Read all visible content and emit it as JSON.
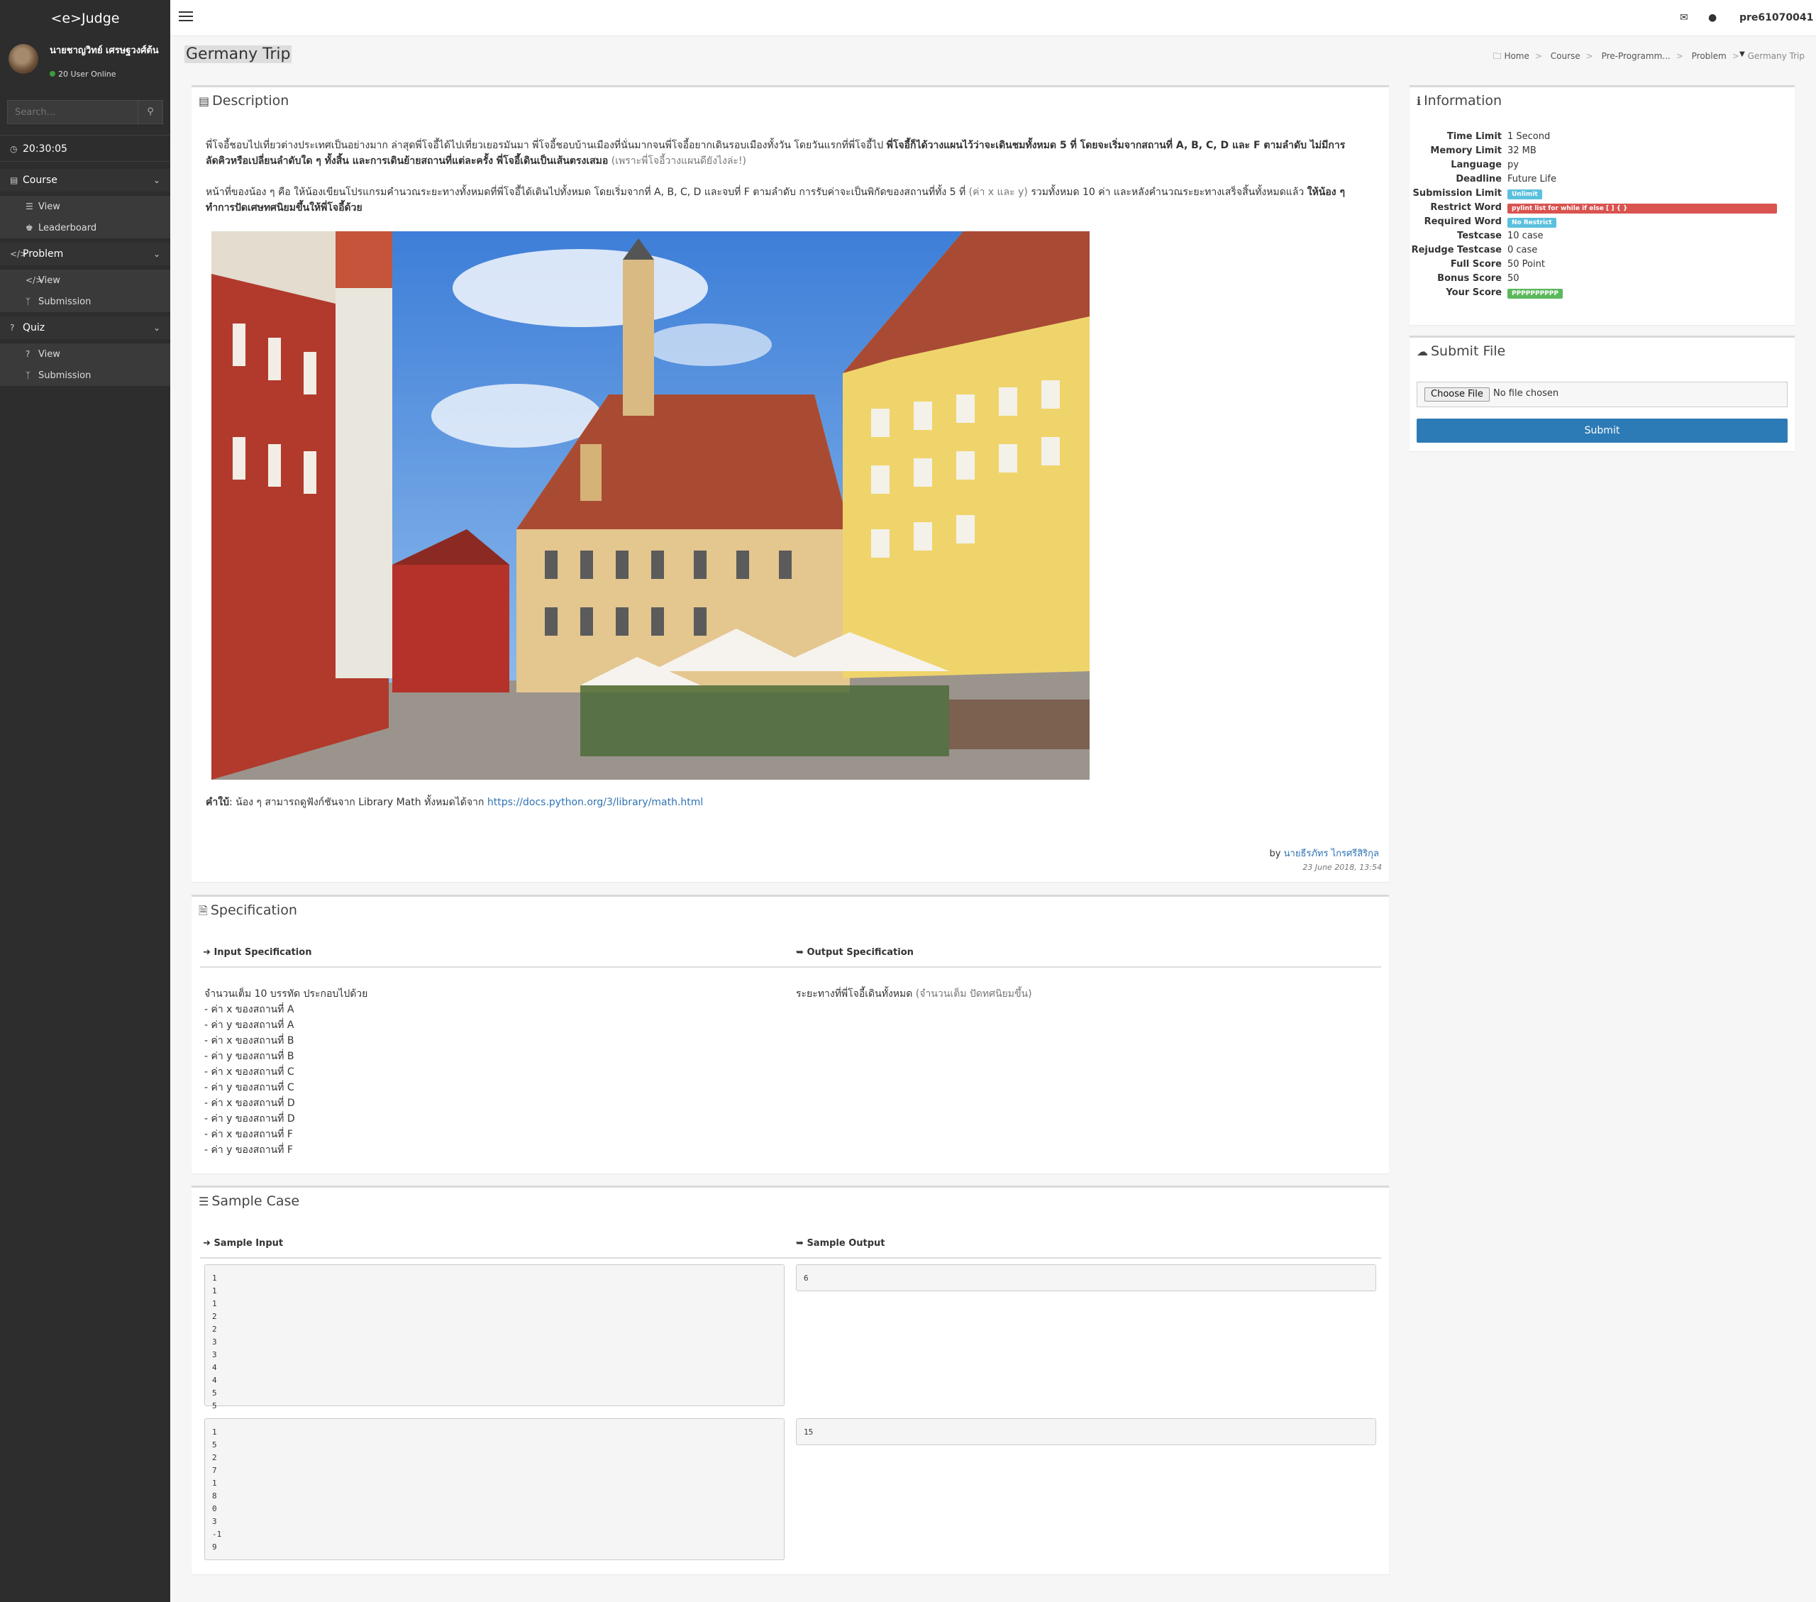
{
  "app": {
    "brand": "<e>Judge"
  },
  "sidebar": {
    "user_name": "นายชาญวิทย์ เศรษฐวงศ์ต้น",
    "online": "20 User Online",
    "search_placeholder": "Search...",
    "clock": "20:30:05",
    "sections": [
      {
        "label": "Course",
        "items": [
          {
            "label": "View"
          },
          {
            "label": "Leaderboard"
          }
        ]
      },
      {
        "label": "Problem",
        "items": [
          {
            "label": "View"
          },
          {
            "label": "Submission"
          }
        ]
      },
      {
        "label": "Quiz",
        "items": [
          {
            "label": "View"
          },
          {
            "label": "Submission"
          }
        ]
      }
    ]
  },
  "topbar": {
    "user": "pre61070041"
  },
  "page": {
    "title": "Germany Trip"
  },
  "breadcrumb": [
    "Home",
    "Course",
    "Pre-Programm...",
    "Problem",
    "Germany Trip"
  ],
  "description": {
    "heading": "Description",
    "p1_a": "พี่โจอี้ชอบไปเที่ยวต่างประเทศเป็นอย่างมาก ล่าสุดพี่โจอี้ได้ไปเที่ยวเยอรมันมา พี่โจอี้ชอบบ้านเมืองที่นั่นมากจนพี่โจอี้อยากเดินรอบเมืองทั้งวัน โดยวันแรกที่พี่โจอี้ไป",
    "p1_b": "พี่โจอี้ก็ได้วางแผนไว้ว่าจะเดินชมทั้งหมด 5 ที่ โดยจะเริ่มจากสถานที่ A, B, C, D และ F ตามลำดับ ไม่มีการลัดคิวหรือเปลี่ยนลำดับใด ๆ ทั้งสิ้น และการเดินย้ายสถานที่แต่ละครั้ง พี่โจอี้เดินเป็นเส้นตรงเสมอ",
    "p1_c": "(เพราะพี่โจอี้วางแผนดียังไงล่ะ!)",
    "p2_a": "หน้าที่ของน้อง ๆ คือ ให้น้องเขียนโปรแกรมคำนวณระยะทางทั้งหมดที่พี่โจอี้ได้เดินไปทั้งหมด โดยเริ่มจากที่ A, B, C, D และจบที่ F ตามลำดับ การรับค่าจะเป็นพิกัดของสถานที่ทั้ง 5 ที่",
    "p2_b": "(ค่า x และ y)",
    "p2_c": "รวมทั้งหมด 10 ค่า และหลังคำนวณระยะทางเสร็จสิ้นทั้งหมดแล้ว",
    "p2_d": "ให้น้อง ๆ ทำการปัดเศษทศนิยมขึ้นให้พี่โจอี้ด้วย",
    "hint_label": "คำใบ้",
    "hint_text": ": น้อง ๆ สามารถดูฟังก์ชันจาก Library Math ทั้งหมดได้จาก",
    "hint_link": "https://docs.python.org/3/library/math.html",
    "by": "by",
    "author": "นายธีรภัทร ไกรศรีสิริกุล",
    "date": "23 June 2018, 13:54"
  },
  "specification": {
    "heading": "Specification",
    "input_label": "Input Specification",
    "output_label": "Output Specification",
    "input_lines": [
      "จำนวนเต็ม 10 บรรทัด ประกอบไปด้วย",
      "- ค่า x ของสถานที่ A",
      "- ค่า y ของสถานที่ A",
      "- ค่า x ของสถานที่ B",
      "- ค่า y ของสถานที่ B",
      "- ค่า x ของสถานที่ C",
      "- ค่า y ของสถานที่ C",
      "- ค่า x ของสถานที่ D",
      "- ค่า y ของสถานที่ D",
      "- ค่า x ของสถานที่ F",
      "- ค่า y ของสถานที่ F"
    ],
    "output_a": "ระยะทางที่พี่โจอี้เดินทั้งหมด",
    "output_b": "(จำนวนเต็ม ปัดทศนิยมขึ้น)"
  },
  "samples": {
    "heading": "Sample Case",
    "input_label": "Sample Input",
    "output_label": "Sample Output",
    "cases": [
      {
        "input": "1\n1\n1\n2\n2\n3\n3\n4\n4\n5\n5",
        "output": "6"
      },
      {
        "input": "1\n5\n2\n7\n1\n8\n0\n3\n-1\n9",
        "output": "15"
      }
    ]
  },
  "information": {
    "heading": "Information",
    "rows": [
      {
        "k": "Time Limit",
        "v": "1 Second"
      },
      {
        "k": "Memory Limit",
        "v": "32 MB"
      },
      {
        "k": "Language",
        "v": "py"
      },
      {
        "k": "Deadline",
        "v": "Future Life"
      },
      {
        "k": "Submission Limit",
        "badge": "Unlimit",
        "color": "#5bc0de"
      },
      {
        "k": "Restrict Word",
        "badge": "pylint list for while if else [ ] { }",
        "color": "#d9534f"
      },
      {
        "k": "Required Word",
        "badge": "No Restrict",
        "color": "#5bc0de"
      },
      {
        "k": "Testcase",
        "v": "10 case"
      },
      {
        "k": "Rejudge Testcase",
        "v": "0 case"
      },
      {
        "k": "Full Score",
        "v": "50 Point"
      },
      {
        "k": "Bonus Score",
        "v": "50"
      },
      {
        "k": "Your Score",
        "badge": "PPPPPPPPPP",
        "color": "#5cb85c"
      }
    ]
  },
  "submit": {
    "heading": "Submit File",
    "choose": "Choose File",
    "nofile": "No file chosen",
    "button": "Submit"
  }
}
